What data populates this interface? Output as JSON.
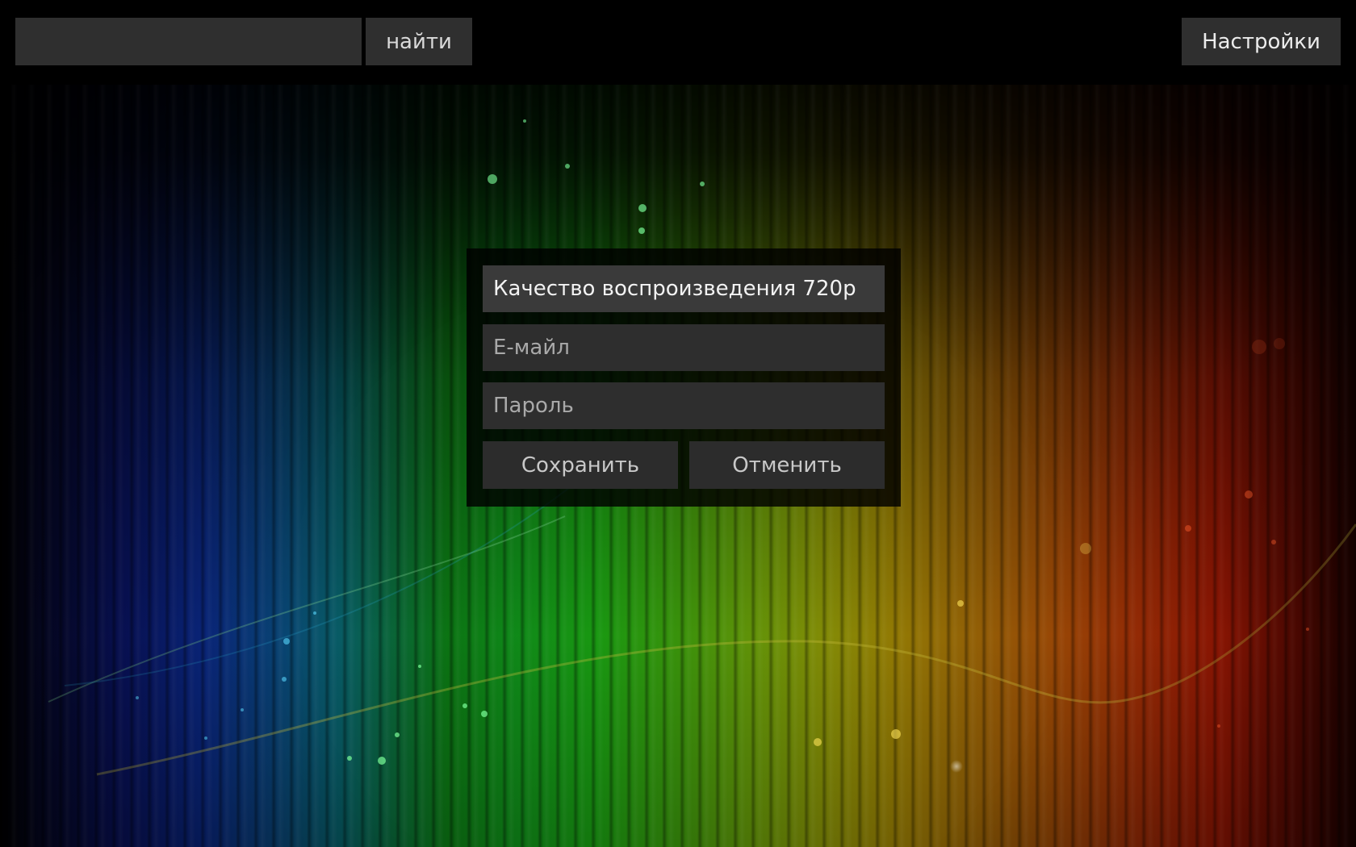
{
  "header": {
    "search": {
      "value": "",
      "placeholder": ""
    },
    "search_button_label": "найти",
    "settings_button_label": "Настройки"
  },
  "settings_panel": {
    "quality_label": "Качество воспроизведения 720p",
    "email_field": {
      "value": "",
      "placeholder": "E-майл"
    },
    "password_field": {
      "value": "",
      "placeholder": "Пароль"
    },
    "save_label": "Сохранить",
    "cancel_label": "Отменить"
  },
  "colors": {
    "panel_background": "#000000",
    "control_background": "#2f2f2f",
    "selected_control_background": "#3a3a3a",
    "text_light": "#f2f2f2",
    "text_muted": "#a9a9a9"
  }
}
